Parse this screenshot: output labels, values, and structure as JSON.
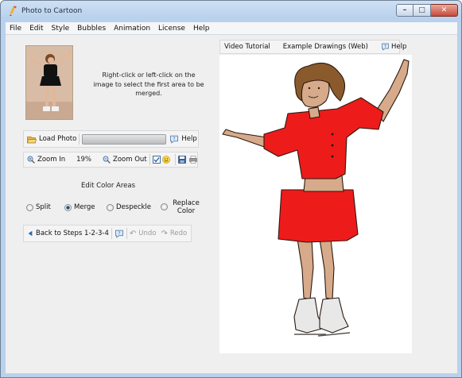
{
  "window": {
    "title": "Photo to Cartoon"
  },
  "menu": [
    "File",
    "Edit",
    "Style",
    "Bubbles",
    "Animation",
    "License",
    "Help"
  ],
  "instructions": "Right-click or left-click on the image to select the first area to be merged.",
  "toolbar1": {
    "load_photo": "Load Photo",
    "help": "Help"
  },
  "toolbar2": {
    "zoom_in": "Zoom In",
    "zoom_value": "19%",
    "zoom_out": "Zoom Out"
  },
  "edit_section": {
    "title": "Edit Color Areas",
    "options": [
      {
        "label": "Split",
        "selected": false
      },
      {
        "label": "Merge",
        "selected": true
      },
      {
        "label": "Despeckle",
        "selected": false
      },
      {
        "label": "Replace Color",
        "selected": false
      }
    ]
  },
  "toolbar3": {
    "back": "Back to Steps 1-2-3-4",
    "undo": "Undo",
    "redo": "Redo"
  },
  "tabs": {
    "video": "Video Tutorial",
    "examples": "Example Drawings (Web)",
    "help": "Help"
  },
  "colors": {
    "accent": "#2a6bb0",
    "dress": "#ee1b1b",
    "skin": "#d6aa8a",
    "hair": "#8a5a2c"
  },
  "icons": [
    "app-icon",
    "folder-open-icon",
    "help-bubble-icon",
    "zoom-in-icon",
    "zoom-out-icon",
    "checkbox-icon",
    "smiley-icon",
    "save-icon",
    "print-icon",
    "back-arrow-icon",
    "undo-icon",
    "redo-icon"
  ]
}
